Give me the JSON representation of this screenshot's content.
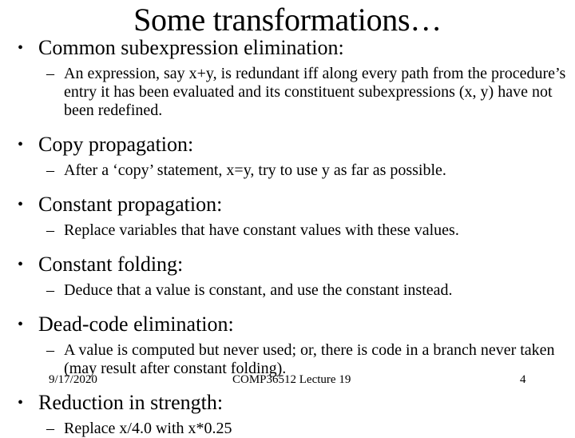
{
  "slide": {
    "title": "Some transformations…",
    "bullet_mark": "•",
    "dash_mark": "–",
    "items": [
      {
        "heading": "Common subexpression elimination:",
        "sub": "An expression, say x+y, is redundant iff along every path from the procedure’s entry it has been evaluated and its constituent subexpressions (x, y) have not been redefined."
      },
      {
        "heading": "Copy propagation:",
        "sub": "After a ‘copy’ statement, x=y, try to use y as far as possible."
      },
      {
        "heading": "Constant propagation:",
        "sub": "Replace variables that have constant values with these values."
      },
      {
        "heading": "Constant folding:",
        "sub": "Deduce that a value is constant, and use the constant instead."
      },
      {
        "heading": "Dead-code elimination:",
        "sub": "A value is computed but never used; or, there is code in a branch never taken (may result after constant folding)."
      },
      {
        "heading": "Reduction in strength:",
        "sub": "Replace x/4.0 with x*0.25"
      }
    ]
  },
  "footer": {
    "date": "9/17/2020",
    "course": "COMP36512 Lecture 19",
    "page_number": "4"
  }
}
